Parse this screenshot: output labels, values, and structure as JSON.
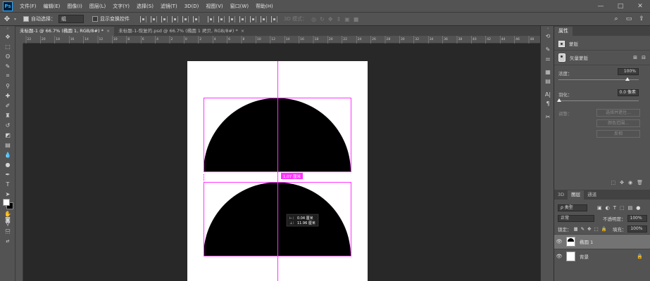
{
  "app": {
    "logo": "Ps"
  },
  "menu": [
    "文件(F)",
    "编辑(E)",
    "图像(I)",
    "图层(L)",
    "文字(Y)",
    "选择(S)",
    "滤镜(T)",
    "3D(D)",
    "视图(V)",
    "窗口(W)",
    "帮助(H)"
  ],
  "options": {
    "auto_select_label": "自动选择：",
    "auto_select_value": "组",
    "show_transform_label": "显示变换控件",
    "mode_3d_label": "3D 模式："
  },
  "tabs": [
    {
      "label": "未标题-1 @ 66.7% (椭圆 1, RGB/8#) *",
      "active": true
    },
    {
      "label": "未标题-1-恢复的.psd @ 66.7% (椭圆 1 拷贝, RGB/8#) *",
      "active": false
    }
  ],
  "ruler": {
    "ticks": [
      "22",
      "20",
      "18",
      "16",
      "14",
      "12",
      "10",
      "8",
      "6",
      "4",
      "2",
      "0",
      "2",
      "4",
      "6",
      "8",
      "10",
      "12",
      "14",
      "16",
      "18",
      "20",
      "22",
      "24",
      "26",
      "28",
      "30",
      "32",
      "34",
      "36",
      "38",
      "40",
      "42",
      "44",
      "46",
      "48"
    ]
  },
  "canvas": {
    "distance_label": "1.07 厘米",
    "readout_line1": "⊢：   0.04 厘米",
    "readout_line2": "⊥：   11.96 厘米",
    "guide_color": "#ff33ff",
    "shape_color": "#000000"
  },
  "properties": {
    "tabs": [
      "属性"
    ],
    "mask_label": "蒙版",
    "vector_mask_label": "矢量蒙版",
    "density_label": "浓度：",
    "density_value": "100%",
    "feather_label": "羽化：",
    "feather_value": "0.0 像素",
    "refine_label": "调整：",
    "btn_select_mask": "选择并遮住...",
    "btn_color_range": "颜色范围...",
    "btn_invert": "反相"
  },
  "layers": {
    "tabs": [
      "3D",
      "图层",
      "通道"
    ],
    "filter_value": "ρ 类型",
    "blend_mode": "正常",
    "opacity_label": "不透明度：",
    "opacity_value": "100%",
    "lock_label": "锁定：",
    "fill_label": "填充：",
    "fill_value": "100%",
    "items": [
      {
        "name": "椭圆 1",
        "selected": true
      },
      {
        "name": "背景",
        "selected": false
      }
    ]
  }
}
